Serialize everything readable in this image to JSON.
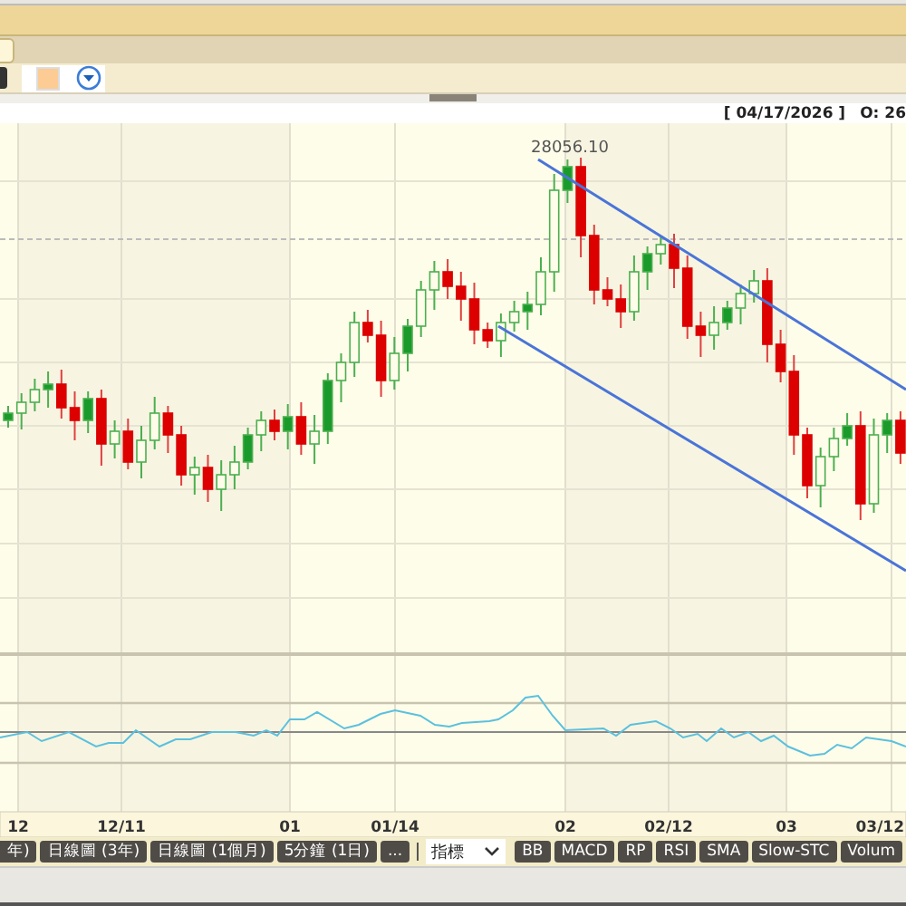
{
  "info_bar": {
    "date": "[ 04/17/2026 ]",
    "open": "O: 26"
  },
  "chart": {
    "peak_label": "28056.10",
    "x_labels": [
      "12",
      "12/11",
      "01",
      "01/14",
      "02",
      "02/12",
      "03",
      "03/12"
    ]
  },
  "range_buttons": [
    "年)",
    "日線圖 (3年)",
    "日線圖 (1個月)",
    "5分鐘 (1日)",
    "..."
  ],
  "indicator_select": {
    "value": "指標"
  },
  "indicator_buttons": [
    "BB",
    "MACD",
    "RP",
    "RSI",
    "SMA",
    "Slow-STC",
    "Volum"
  ]
}
